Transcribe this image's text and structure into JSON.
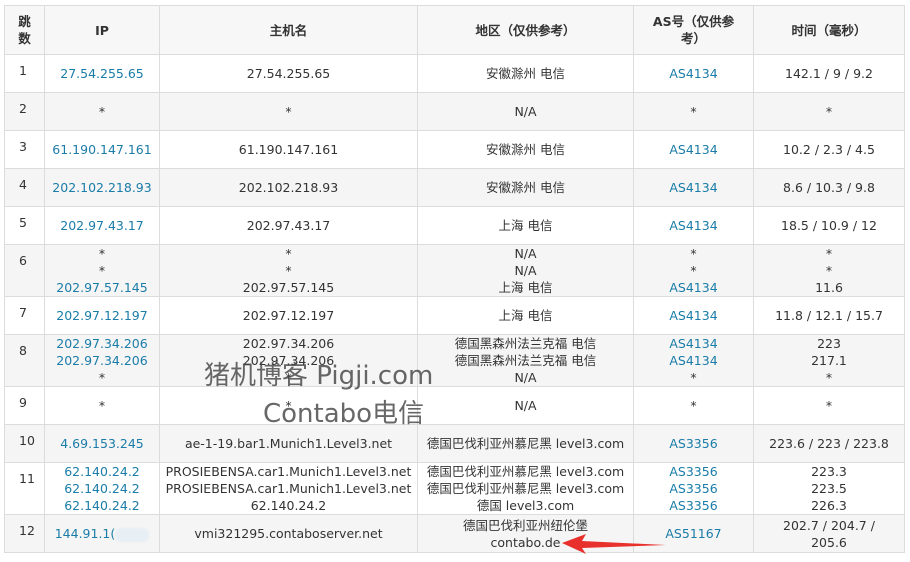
{
  "headers": {
    "hop": "跳数",
    "ip": "IP",
    "host": "主机名",
    "region": "地区（仅供参考）",
    "as": "AS号（仅供参考）",
    "time": "时间（毫秒）"
  },
  "rows": [
    {
      "hop": "1",
      "ip": [
        "27.54.255.65"
      ],
      "host": [
        "27.54.255.65"
      ],
      "region": [
        "安徽滁州 电信"
      ],
      "as": [
        "AS4134"
      ],
      "time": [
        "142.1 / 9 / 9.2"
      ]
    },
    {
      "hop": "2",
      "ip": [
        "*"
      ],
      "host": [
        "*"
      ],
      "region": [
        "N/A"
      ],
      "as": [
        "*"
      ],
      "time": [
        "*"
      ]
    },
    {
      "hop": "3",
      "ip": [
        "61.190.147.161"
      ],
      "host": [
        "61.190.147.161"
      ],
      "region": [
        "安徽滁州 电信"
      ],
      "as": [
        "AS4134"
      ],
      "time": [
        "10.2 / 2.3 / 4.5"
      ]
    },
    {
      "hop": "4",
      "ip": [
        "202.102.218.93"
      ],
      "host": [
        "202.102.218.93"
      ],
      "region": [
        "安徽滁州 电信"
      ],
      "as": [
        "AS4134"
      ],
      "time": [
        "8.6 / 10.3 / 9.8"
      ]
    },
    {
      "hop": "5",
      "ip": [
        "202.97.43.17"
      ],
      "host": [
        "202.97.43.17"
      ],
      "region": [
        "上海 电信"
      ],
      "as": [
        "AS4134"
      ],
      "time": [
        "18.5 / 10.9 / 12"
      ]
    },
    {
      "hop": "6",
      "ip": [
        "*",
        "*",
        "202.97.57.145"
      ],
      "host": [
        "*",
        "*",
        "202.97.57.145"
      ],
      "region": [
        "N/A",
        "N/A",
        "上海 电信"
      ],
      "as": [
        "*",
        "*",
        "AS4134"
      ],
      "time": [
        "*",
        "*",
        "11.6"
      ]
    },
    {
      "hop": "7",
      "ip": [
        "202.97.12.197"
      ],
      "host": [
        "202.97.12.197"
      ],
      "region": [
        "上海 电信"
      ],
      "as": [
        "AS4134"
      ],
      "time": [
        "11.8 / 12.1 / 15.7"
      ]
    },
    {
      "hop": "8",
      "ip": [
        "202.97.34.206",
        "202.97.34.206",
        "*"
      ],
      "host": [
        "202.97.34.206",
        "202.97.34.206",
        "*"
      ],
      "region": [
        "德国黑森州法兰克福 电信",
        "德国黑森州法兰克福 电信",
        "N/A"
      ],
      "as": [
        "AS4134",
        "AS4134",
        "*"
      ],
      "time": [
        "223",
        "217.1",
        "*"
      ]
    },
    {
      "hop": "9",
      "ip": [
        "*"
      ],
      "host": [
        "*"
      ],
      "region": [
        "N/A"
      ],
      "as": [
        "*"
      ],
      "time": [
        "*"
      ]
    },
    {
      "hop": "10",
      "ip": [
        "4.69.153.245"
      ],
      "host": [
        "ae-1-19.bar1.Munich1.Level3.net"
      ],
      "region": [
        "德国巴伐利亚州慕尼黑 level3.com"
      ],
      "as": [
        "AS3356"
      ],
      "time": [
        "223.6 / 223 / 223.8"
      ]
    },
    {
      "hop": "11",
      "ip": [
        "62.140.24.2",
        "62.140.24.2",
        "62.140.24.2"
      ],
      "host": [
        "PROSIEBENSA.car1.Munich1.Level3.net",
        "PROSIEBENSA.car1.Munich1.Level3.net",
        "62.140.24.2"
      ],
      "region": [
        "德国巴伐利亚州慕尼黑 level3.com",
        "德国巴伐利亚州慕尼黑 level3.com",
        "德国 level3.com"
      ],
      "as": [
        "AS3356",
        "AS3356",
        "AS3356"
      ],
      "time": [
        "223.3",
        "223.5",
        "226.3"
      ]
    },
    {
      "hop": "12",
      "ip": [
        "144.91.1("
      ],
      "host": [
        "vmi321295.contaboserver.net"
      ],
      "region": [
        "德国巴伐利亚州纽伦堡",
        "contabo.de"
      ],
      "as": [
        "AS51167"
      ],
      "time": [
        "202.7 / 204.7 /",
        "205.6"
      ]
    }
  ],
  "watermark": {
    "line1": "猪机博客 Pigji.com",
    "line2": "Contabo电信"
  },
  "colors": {
    "link": "#1a7ca8",
    "arrow": "#e8302c",
    "row_alt": "#f5f5f5",
    "border": "#dcdcdc"
  }
}
